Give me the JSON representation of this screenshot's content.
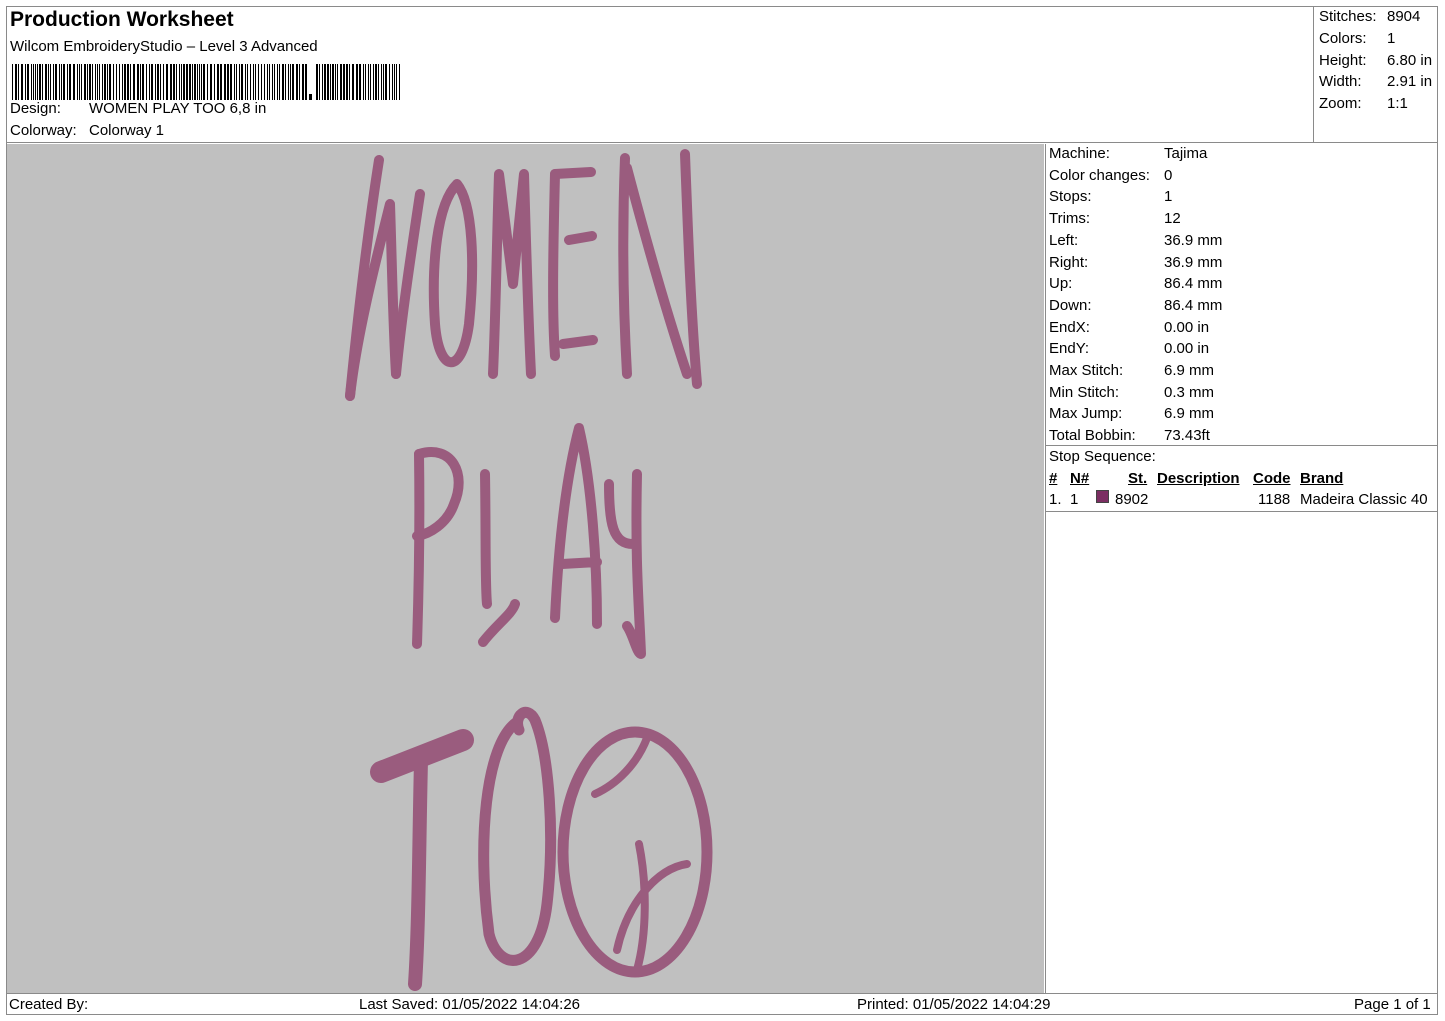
{
  "header": {
    "title": "Production Worksheet",
    "subtitle": "Wilcom EmbroideryStudio – Level 3 Advanced",
    "design_label": "Design:",
    "design_value": "WOMEN PLAY TOO 6,8 in",
    "colorway_label": "Colorway:",
    "colorway_value": "Colorway 1"
  },
  "stats": [
    {
      "label": "Stitches:",
      "value": "8904"
    },
    {
      "label": "Colors:",
      "value": "1"
    },
    {
      "label": "Height:",
      "value": "6.80 in"
    },
    {
      "label": "Width:",
      "value": "2.91 in"
    },
    {
      "label": "Zoom:",
      "value": "1:1"
    }
  ],
  "machine_info": [
    {
      "label": "Machine:",
      "value": "Tajima"
    },
    {
      "label": "Color changes:",
      "value": "0"
    },
    {
      "label": "Stops:",
      "value": "1"
    },
    {
      "label": "Trims:",
      "value": "12"
    },
    {
      "label": "Left:",
      "value": "36.9 mm"
    },
    {
      "label": "Right:",
      "value": "36.9 mm"
    },
    {
      "label": "Up:",
      "value": "86.4 mm"
    },
    {
      "label": "Down:",
      "value": "86.4 mm"
    },
    {
      "label": "EndX:",
      "value": "0.00 in"
    },
    {
      "label": "EndY:",
      "value": "0.00 in"
    },
    {
      "label": "Max Stitch:",
      "value": "6.9 mm"
    },
    {
      "label": "Min Stitch:",
      "value": "0.3 mm"
    },
    {
      "label": "Max Jump:",
      "value": "6.9 mm"
    },
    {
      "label": "Total Bobbin:",
      "value": "73.43ft"
    }
  ],
  "stop_sequence": {
    "title": "Stop Sequence:",
    "columns": [
      "#",
      "N#",
      "St.",
      "Description",
      "Code",
      "Brand"
    ],
    "rows": [
      {
        "index": "1.",
        "n": "1",
        "st": "8902",
        "description": "",
        "code": "1188",
        "brand": "Madeira Classic 40",
        "color": "#7b2e62"
      }
    ]
  },
  "design_preview": {
    "lines": [
      "WOMEN",
      "PLAY",
      "TOO"
    ],
    "thread_color": "#9a5c7e"
  },
  "footer": {
    "created_by": "Created By:",
    "last_saved": "Last Saved: 01/05/2022 14:04:26",
    "printed": "Printed: 01/05/2022 14:04:29",
    "page": "Page 1 of 1"
  }
}
